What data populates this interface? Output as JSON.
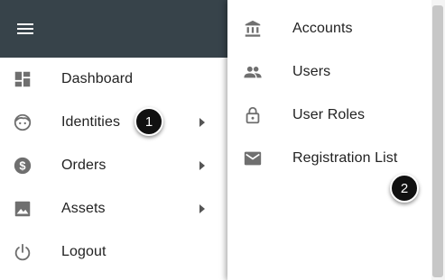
{
  "appbar": {
    "menu_icon": "hamburger-menu-icon",
    "background": "#37434a"
  },
  "nav": {
    "items": [
      {
        "label": "Dashboard",
        "icon": "dashboard-icon",
        "has_submenu": false
      },
      {
        "label": "Identities",
        "icon": "face-icon",
        "has_submenu": true
      },
      {
        "label": "Orders",
        "icon": "dollar-icon",
        "has_submenu": true
      },
      {
        "label": "Assets",
        "icon": "image-icon",
        "has_submenu": true
      },
      {
        "label": "Logout",
        "icon": "power-icon",
        "has_submenu": false
      }
    ]
  },
  "submenu": {
    "items": [
      {
        "label": "Accounts",
        "icon": "bank-icon"
      },
      {
        "label": "Users",
        "icon": "people-icon"
      },
      {
        "label": "User Roles",
        "icon": "lock-icon"
      },
      {
        "label": "Registration List",
        "icon": "mail-icon"
      }
    ]
  },
  "badges": {
    "step1": "1",
    "step2": "2"
  }
}
